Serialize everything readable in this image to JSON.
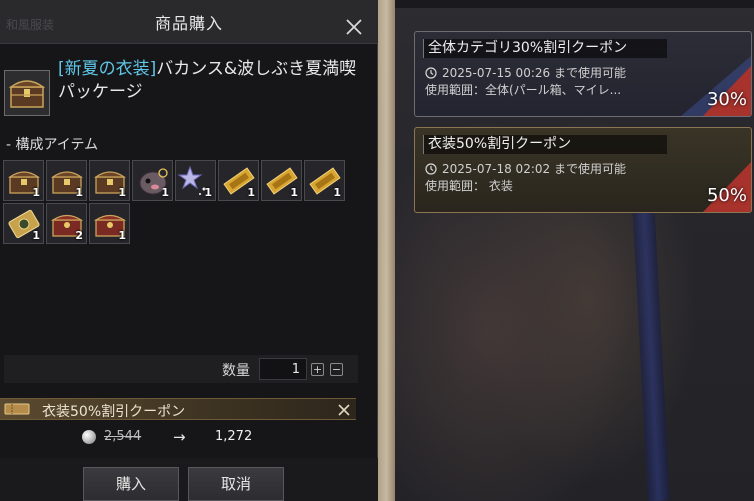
{
  "purchase_window": {
    "ghost_title": "和風服装",
    "title": "商品購入",
    "product": {
      "tag": "[新夏の衣装]",
      "name": "バカンス&波しぶき夏満喫パッケージ"
    },
    "components_label": "- 構成アイテム",
    "items": [
      {
        "icon": "treasure-chest-icon",
        "count": "1"
      },
      {
        "icon": "treasure-chest-icon",
        "count": "1"
      },
      {
        "icon": "treasure-chest-icon",
        "count": "1"
      },
      {
        "icon": "pet-creature-icon",
        "count": "1"
      },
      {
        "icon": "star-wand-icon",
        "count": "1"
      },
      {
        "icon": "gold-ticket-icon",
        "count": "1"
      },
      {
        "icon": "gold-ticket-icon",
        "count": "1"
      },
      {
        "icon": "gold-ticket-icon",
        "count": "1"
      },
      {
        "icon": "gold-token-icon",
        "count": "1"
      },
      {
        "icon": "red-chest-icon",
        "count": "2"
      },
      {
        "icon": "red-chest-icon",
        "count": "1"
      }
    ],
    "quantity_label": "数量",
    "quantity_value": "1",
    "applied_coupon": "衣装50%割引クーポン",
    "old_price": "2,544",
    "arrow": "→",
    "new_price": "1,272",
    "buy_label": "購入",
    "cancel_label": "取消"
  },
  "coupons": [
    {
      "name": "全体カテゴリ30%割引クーポン",
      "expiry": "2025-07-15 00:26 まで使用可能",
      "scope": "使用範囲：全体(パール箱、マイレ...",
      "percent": "30%",
      "ribbon_color": "#a8322c"
    },
    {
      "name": "衣装50%割引クーポン",
      "expiry": "2025-07-18 02:02 まで使用可能",
      "scope": "使用範囲： 衣装",
      "percent": "50%",
      "ribbon_color": "#a8322c"
    }
  ],
  "colors": {
    "tag_blue": "#5fc6e8",
    "coupon_gold": "#8b7654"
  }
}
